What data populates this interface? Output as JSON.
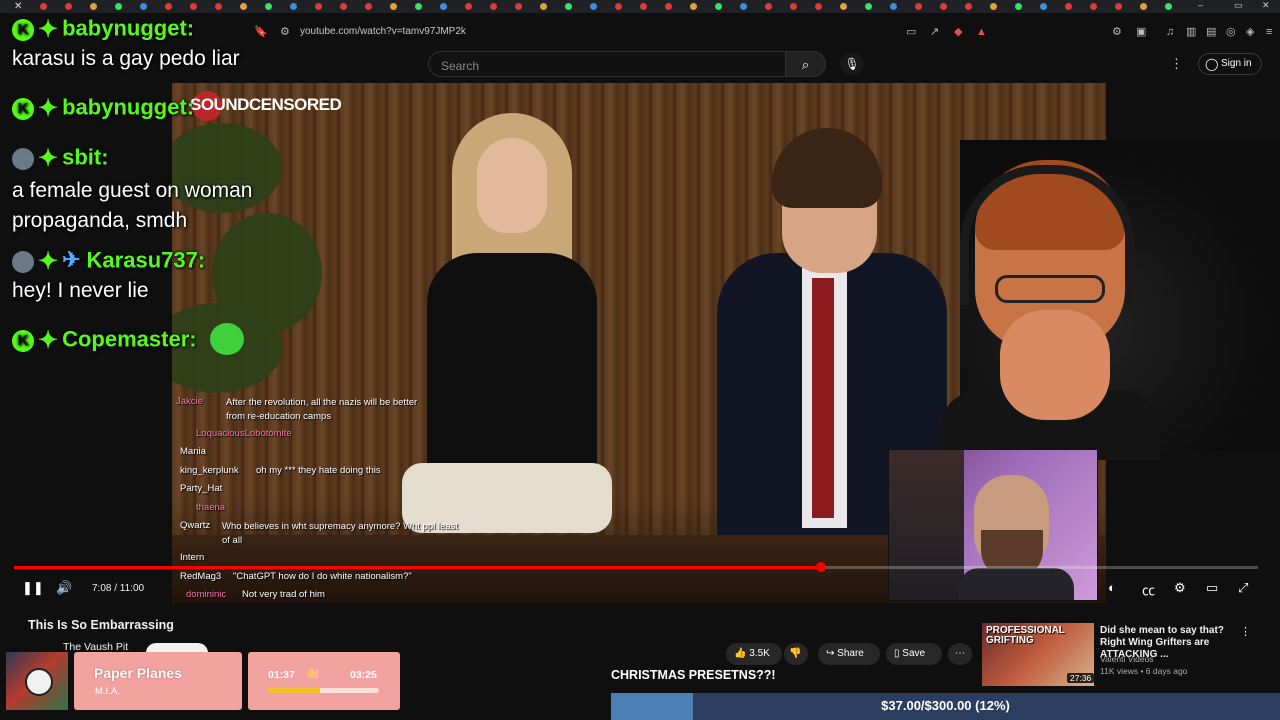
{
  "browser": {
    "url": "youtube.com/watch?v=tamv97JMP2k"
  },
  "youtube": {
    "search_placeholder": "Search",
    "sign_in": "Sign in",
    "video_title": "This Is So Embarrassing",
    "channel": "The Vaush Pit",
    "time": "7:08 / 11:00",
    "progress": 0.649,
    "likes": "3.5K",
    "share": "Share",
    "save": "Save"
  },
  "video_overlay": {
    "logo_text": "SOUNDCENSORED"
  },
  "big_chat": [
    {
      "user": "babynugget:",
      "message": "karasu is a gay pedo liar",
      "badge": "kick"
    },
    {
      "user": "babynugget:",
      "message": "",
      "badge": "kick"
    },
    {
      "user": "sbit:",
      "message": "a female guest on woman propaganda, smdh",
      "badge": "avatar"
    },
    {
      "user": "Karasu737:",
      "message": "hey! I never lie",
      "badge": "avatar"
    },
    {
      "user": "Copemaster:",
      "message": "",
      "badge": "kick"
    }
  ],
  "small_chat": [
    {
      "user": "Jakcie",
      "message": "After the revolution, all the nazis will be better from re-education camps",
      "color": "#ff6fa6"
    },
    {
      "user": "LoquaciousLobotomite",
      "message": "",
      "color": "#ff6fa6"
    },
    {
      "user": "Mania",
      "message": "",
      "color": "#ffffff"
    },
    {
      "user": "king_kerplunk",
      "message": "oh my *** they hate doing this",
      "color": "#ffffff"
    },
    {
      "user": "Party_Hat",
      "message": "",
      "color": "#ffffff"
    },
    {
      "user": "thaena",
      "message": "",
      "color": "#ff6fa6"
    },
    {
      "user": "Qwartz",
      "message": "Who believes in wht supremacy anymore? Wht ppl least of all",
      "color": "#ffffff"
    },
    {
      "user": "Intern",
      "message": "",
      "color": "#ffffff"
    },
    {
      "user": "RedMag3",
      "message": "\"ChatGPT how do I do white nationalism?\"",
      "color": "#ffffff"
    },
    {
      "user": "domininic",
      "message": "Not very trad of him",
      "color": "#ff6fa6"
    }
  ],
  "suggestion": {
    "thumb_text": "PROFESSIONAL GRIFTING",
    "duration": "27:36",
    "title": "Did she mean to say that? Right Wing Grifters are ATTACKING ...",
    "channel": "Valenti Videos",
    "meta": "11K views • 6 days ago"
  },
  "music": {
    "song": "Paper Planes",
    "artist": "M.I.A.",
    "elapsed": "01:37",
    "total": "03:25",
    "progress": 0.47
  },
  "donation_goal": {
    "label": "CHRISTMAS PRESETNS??!",
    "text": "$37.00/$300.00 (12%)",
    "fraction": 0.1233
  },
  "colors": {
    "kick_green": "#53fc18",
    "progress_red": "#ff0000",
    "goal_fill": "#4d7fb7",
    "goal_bg": "#2c3e60",
    "music_card": "#f2a3a0"
  },
  "icons": [
    "close-icon",
    "bookmark-icon",
    "site-info-icon",
    "search-icon",
    "mic-icon",
    "more-icon",
    "user-icon",
    "pause-icon",
    "volume-icon",
    "miniplayer-icon",
    "captions-icon",
    "settings-icon",
    "theater-icon",
    "fullscreen-icon",
    "like-icon",
    "dislike-icon",
    "share-icon",
    "save-icon"
  ]
}
